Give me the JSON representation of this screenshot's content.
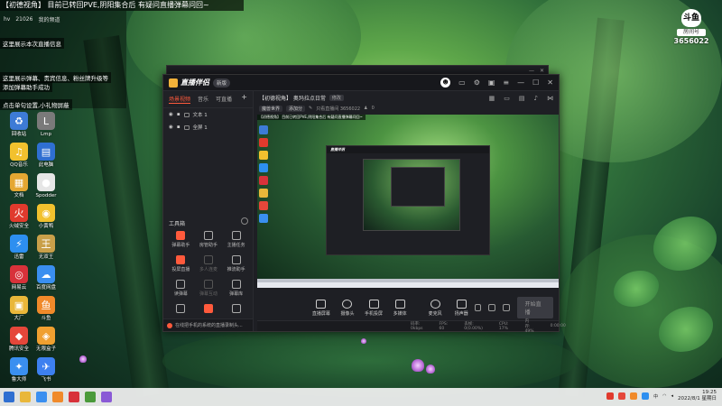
{
  "banner": {
    "text": "【初德视角】 目前已转回PVE,阴阳集合后 有疑问直播弹幕问回~"
  },
  "top_toolbar": {
    "items": [
      "⬛",
      "21026",
      "",
      ""
    ],
    "label_left": "hv",
    "label_mid": "我的频道"
  },
  "toasts": [
    "这里展示本次直播信息",
    "这里展示弹幕、贵宾信息、粉丝牌升级等",
    "添加弹幕助手成功",
    "点击单句设置,小礼物屏蔽"
  ],
  "room": {
    "logo": "斗鱼",
    "label": "房间号",
    "number": "3656022"
  },
  "desktop": [
    {
      "label": "回收站",
      "color": "#3d7bd6",
      "glyph": "♻"
    },
    {
      "label": "Lmp",
      "color": "#7a7a7a",
      "glyph": "L"
    },
    {
      "label": "QQ音乐",
      "color": "#f2c12e",
      "glyph": "♫"
    },
    {
      "label": "此电脑",
      "color": "#2f6fd1",
      "glyph": "▤"
    },
    {
      "label": "文档",
      "color": "#e5a732",
      "glyph": "▦"
    },
    {
      "label": "Spodder",
      "color": "#e6e6e6",
      "glyph": "●"
    },
    {
      "label": "火绒安全",
      "color": "#e03a2d",
      "glyph": "火"
    },
    {
      "label": "小黄鸭",
      "color": "#f2c12e",
      "glyph": "◉"
    },
    {
      "label": "迅雷",
      "color": "#2d8ff0",
      "glyph": "⚡"
    },
    {
      "label": "无双王",
      "color": "#c9a04a",
      "glyph": "王"
    },
    {
      "label": "网易云",
      "color": "#d8323a",
      "glyph": "◎"
    },
    {
      "label": "百度网盘",
      "color": "#3a8ff0",
      "glyph": "☁"
    },
    {
      "label": "大厂",
      "color": "#e9b73a",
      "glyph": "▣"
    },
    {
      "label": "斗鱼",
      "color": "#f08a2a",
      "glyph": "鱼"
    },
    {
      "label": "腾讯安全",
      "color": "#e5473a",
      "glyph": "◆"
    },
    {
      "label": "无限盒子",
      "color": "#f0a030",
      "glyph": "◈"
    },
    {
      "label": "鲁大师",
      "color": "#3a8ff0",
      "glyph": "✦"
    },
    {
      "label": "飞书",
      "color": "#3d80f0",
      "glyph": "✈"
    }
  ],
  "app": {
    "name": "直播伴侣",
    "version": "新版",
    "left_tabs": [
      "场景视频",
      "音乐",
      "可直播"
    ],
    "scenes": [
      "文本 1",
      "全屏 1"
    ],
    "tools_title": "工具箱",
    "tools": [
      {
        "label": "弹幕助手",
        "style": "red"
      },
      {
        "label": "房管助手",
        "style": ""
      },
      {
        "label": "主播任务",
        "style": ""
      },
      {
        "label": "投屏直播",
        "style": "red"
      },
      {
        "label": "多人连麦",
        "style": "dim"
      },
      {
        "label": "推流助手",
        "style": ""
      },
      {
        "label": "读弹幕",
        "style": ""
      },
      {
        "label": "弹幕互动",
        "style": "dim"
      },
      {
        "label": "弹幕库",
        "style": ""
      },
      {
        "label": "",
        "style": ""
      },
      {
        "label": "",
        "style": "red"
      },
      {
        "label": "",
        "style": ""
      }
    ],
    "footer_hint": "在线把手机的系统的直播录制头...",
    "stream_title": "【初德视角】 奥玛拉点日常",
    "stream_tag": "修改",
    "sub_chips": [
      "魔兽世界",
      "添加分"
    ],
    "sub_info": "只看直播间  3656022",
    "sub_count": "0",
    "preview_banner": "【初德视角】 目前已转回PVE,阴阳集合后 有疑问直播弹幕问回~",
    "preview_title": "直播伴侣",
    "bottom_items": [
      {
        "label": "直播屏幕",
        "shape": ""
      },
      {
        "label": "摄像头",
        "shape": "round"
      },
      {
        "label": "手机投屏",
        "shape": ""
      },
      {
        "label": "多媒体",
        "shape": ""
      }
    ],
    "mic_label": "麦克风",
    "speaker_label": "扬声器",
    "start_label": "开始直播",
    "stats": [
      "码率: 0kbps",
      "FPS: 60",
      "丢帧: 0(0.00%)",
      "CPU: 17%",
      "内存: 49%",
      "0:00:00"
    ]
  },
  "taskbar": {
    "time": "19:25",
    "date": "2022/8/1 星期日",
    "lang": "中"
  },
  "colors": {
    "accent": "#ff5a3c",
    "app_bg": "#1e1f24"
  }
}
